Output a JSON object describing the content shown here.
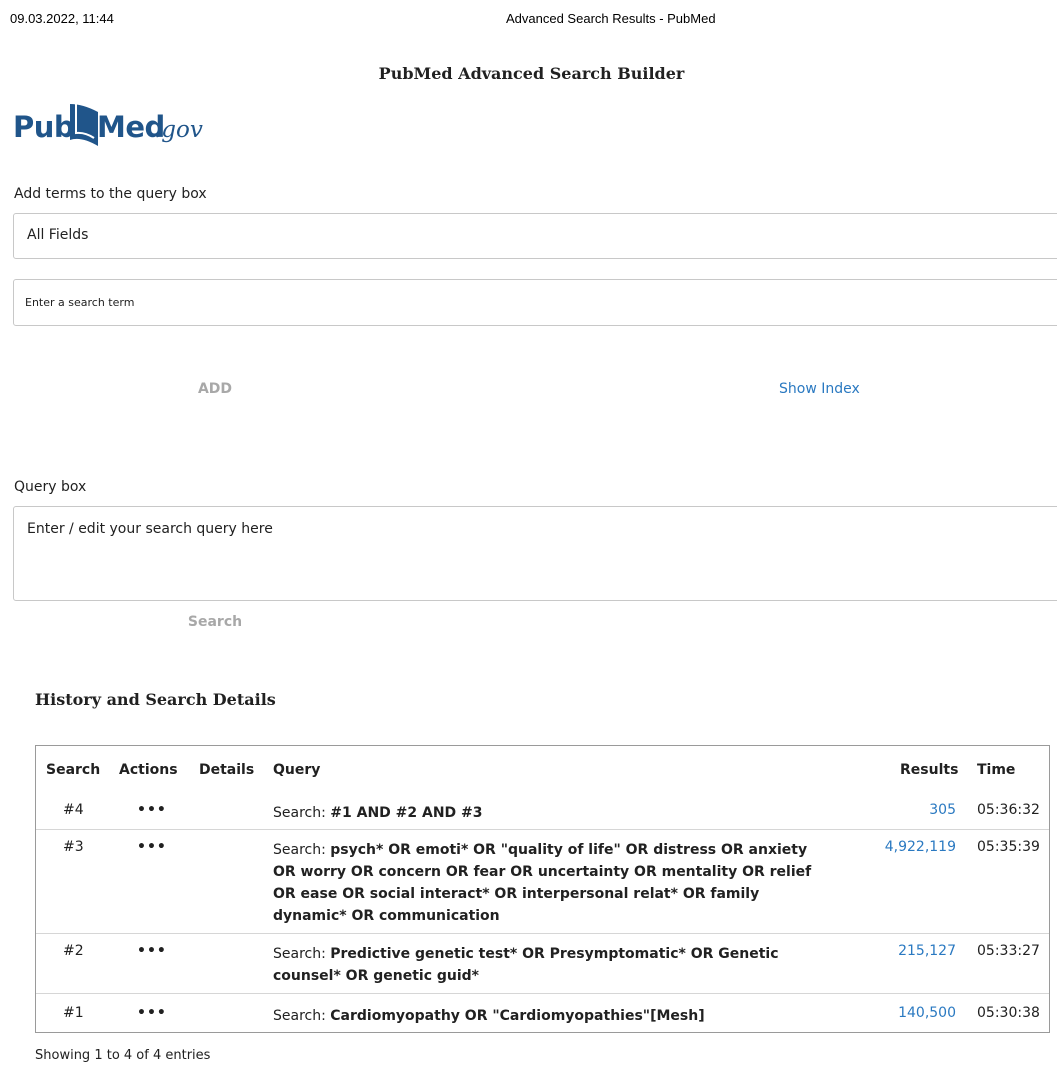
{
  "print_header": {
    "date": "09.03.2022, 11:44",
    "title": "Advanced Search Results - PubMed"
  },
  "page_title": "PubMed Advanced Search Builder",
  "logo": {
    "part1": "Pub",
    "part2": "Med",
    "suffix": ".gov"
  },
  "builder": {
    "add_terms_label": "Add terms to the query box",
    "field_selected": "All Fields",
    "term_placeholder": "Enter a search term",
    "add_label": "ADD",
    "show_index_label": "Show Index"
  },
  "query_box": {
    "label": "Query box",
    "placeholder": "Enter / edit your search query here",
    "search_label": "Search"
  },
  "history": {
    "title": "History and Search Details",
    "headers": {
      "search": "Search",
      "actions": "Actions",
      "details": "Details",
      "query": "Query",
      "results": "Results",
      "time": "Time"
    },
    "rows": [
      {
        "num": "#4",
        "actions": "•••",
        "prefix": "Search: ",
        "query": "#1 AND #2 AND #3",
        "results": "305",
        "time": "05:36:32"
      },
      {
        "num": "#3",
        "actions": "•••",
        "prefix": "Search: ",
        "query": "psych* OR emoti* OR \"quality of life\" OR distress OR anxiety OR worry OR concern OR fear OR uncertainty OR mentality OR relief OR ease OR social interact* OR interpersonal relat* OR family dynamic* OR communication",
        "results": "4,922,119",
        "time": "05:35:39"
      },
      {
        "num": "#2",
        "actions": "•••",
        "prefix": "Search: ",
        "query": "Predictive genetic test* OR Presymptomatic* OR Genetic counsel* OR genetic guid*",
        "results": "215,127",
        "time": "05:33:27"
      },
      {
        "num": "#1",
        "actions": "•••",
        "prefix": "Search: ",
        "query": "Cardiomyopathy OR \"Cardiomyopathies\"[Mesh]",
        "results": "140,500",
        "time": "05:30:38"
      }
    ],
    "footer": "Showing 1 to 4 of 4 entries"
  },
  "colors": {
    "brand": "#20558a",
    "link": "#2a79c1",
    "disabled": "#a8a8a8"
  }
}
